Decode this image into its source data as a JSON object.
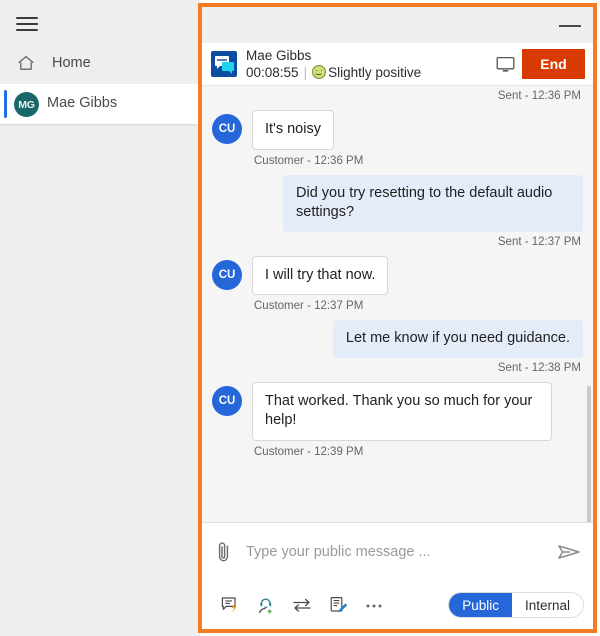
{
  "sidebar": {
    "menu_icon": "hamburger-icon",
    "items": [
      {
        "label": "Home",
        "icon": "home-icon"
      },
      {
        "label": "Mae Gibbs",
        "initials": "MG",
        "active": true
      }
    ]
  },
  "window": {
    "minimize_label": "Minimize",
    "highlight_color": "#f57c20"
  },
  "conversation": {
    "icon": "chat-bubbles-icon",
    "name": "Mae Gibbs",
    "timer": "00:08:55",
    "separator": "|",
    "sentiment_icon": "slightly-positive-face-icon",
    "sentiment": "Slightly positive",
    "monitor_icon": "monitor-icon",
    "end_label": "End"
  },
  "messages": [
    {
      "kind": "stamp_right",
      "text": "Sent - 12:36 PM"
    },
    {
      "kind": "incoming",
      "avatar": "CU",
      "text": "It's noisy",
      "stamp": "Customer - 12:36 PM"
    },
    {
      "kind": "outgoing",
      "text": "Did you try resetting to the default audio settings?",
      "stamp": "Sent - 12:37 PM"
    },
    {
      "kind": "incoming",
      "avatar": "CU",
      "text": "I will try that now.",
      "stamp": "Customer - 12:37 PM"
    },
    {
      "kind": "outgoing",
      "text": "Let me know if you need guidance.",
      "stamp": "Sent - 12:38 PM"
    },
    {
      "kind": "incoming",
      "avatar": "CU",
      "text": "That worked. Thank you so much for your help!",
      "stamp": "Customer - 12:39 PM"
    }
  ],
  "composer": {
    "attach_icon": "paperclip-icon",
    "placeholder": "Type your public message ...",
    "value": "",
    "send_icon": "send-paper-plane-icon",
    "tools": [
      {
        "icon": "quick-reply-icon"
      },
      {
        "icon": "add-agent-icon"
      },
      {
        "icon": "transfer-icon"
      },
      {
        "icon": "notes-icon"
      },
      {
        "icon": "more-options-icon"
      }
    ],
    "mode_public": "Public",
    "mode_internal": "Internal"
  }
}
